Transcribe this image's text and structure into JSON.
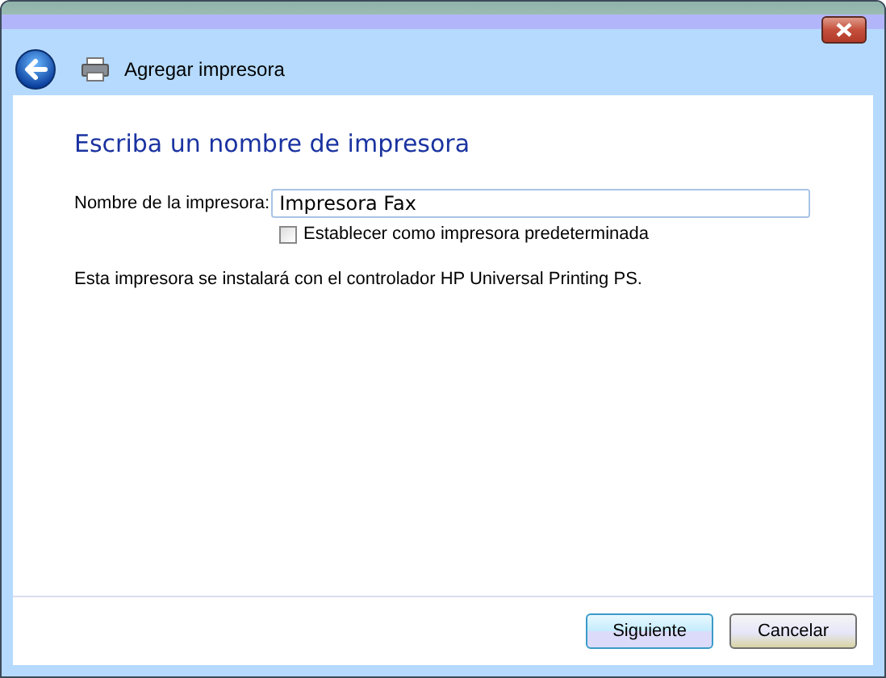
{
  "window": {
    "title": "Agregar impresora"
  },
  "heading": "Escriba un nombre de impresora",
  "name_field": {
    "label": "Nombre de la impresora:",
    "value": "Impresora Fax"
  },
  "default_checkbox": {
    "label": "Establecer como impresora predeterminada",
    "checked": false
  },
  "info": "Esta impresora se instalará con el controlador HP Universal Printing PS.",
  "buttons": [
    {
      "label": "Siguiente",
      "kind": "primary"
    },
    {
      "label": "Cancelar",
      "kind": "secondary"
    }
  ]
}
